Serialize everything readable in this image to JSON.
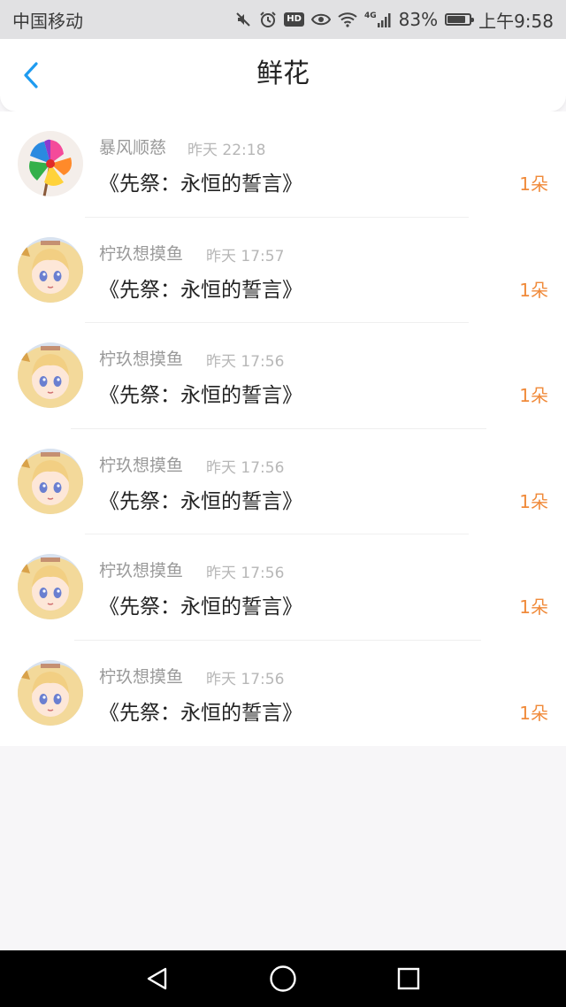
{
  "status_bar": {
    "carrier": "中国移动",
    "signal_label": "4G",
    "battery": "83%",
    "battery_level": 0.83,
    "time": "上午9:58",
    "hd_label": "HD",
    "icons": [
      "mute-icon",
      "alarm-icon",
      "hd-icon",
      "eye-icon",
      "wifi-icon",
      "signal-icon",
      "battery-icon"
    ]
  },
  "header": {
    "title": "鲜花",
    "back_icon": "chevron-left-icon",
    "back_color": "#1e9bf0"
  },
  "records": [
    {
      "name": "暴风顺慈",
      "time": "昨天 22:18",
      "gift": "《先祭：永恒的誓言》",
      "count": "1朵",
      "avatar": "pinwheel"
    },
    {
      "name": "柠玖想摸鱼",
      "time": "昨天 17:57",
      "gift": "《先祭：永恒的誓言》",
      "count": "1朵",
      "avatar": "anime-girl"
    },
    {
      "name": "柠玖想摸鱼",
      "time": "昨天 17:56",
      "gift": "《先祭：永恒的誓言》",
      "count": "1朵",
      "avatar": "anime-girl"
    },
    {
      "name": "柠玖想摸鱼",
      "time": "昨天 17:56",
      "gift": "《先祭：永恒的誓言》",
      "count": "1朵",
      "avatar": "anime-girl"
    },
    {
      "name": "柠玖想摸鱼",
      "time": "昨天 17:56",
      "gift": "《先祭：永恒的誓言》",
      "count": "1朵",
      "avatar": "anime-girl"
    },
    {
      "name": "柠玖想摸鱼",
      "time": "昨天 17:56",
      "gift": "《先祭：永恒的誓言》",
      "count": "1朵",
      "avatar": "anime-girl"
    }
  ],
  "colors": {
    "accent_orange": "#f08a3a",
    "name_gray": "#9a9a9a",
    "time_gray": "#b7b7b7"
  },
  "system_nav": [
    "back-triangle-icon",
    "home-circle-icon",
    "recents-square-icon"
  ]
}
